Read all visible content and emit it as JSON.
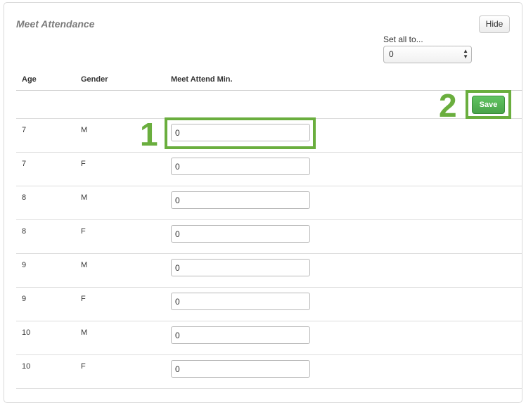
{
  "panel": {
    "title": "Meet Attendance",
    "hide_label": "Hide",
    "set_all_label": "Set all to...",
    "set_all_value": "0"
  },
  "table": {
    "headers": [
      "Age",
      "Gender",
      "Meet Attend Min."
    ],
    "save_label": "Save",
    "rows": [
      {
        "age": "7",
        "gender": "M",
        "min": "0"
      },
      {
        "age": "7",
        "gender": "F",
        "min": "0"
      },
      {
        "age": "8",
        "gender": "M",
        "min": "0"
      },
      {
        "age": "8",
        "gender": "F",
        "min": "0"
      },
      {
        "age": "9",
        "gender": "M",
        "min": "0"
      },
      {
        "age": "9",
        "gender": "F",
        "min": "0"
      },
      {
        "age": "10",
        "gender": "M",
        "min": "0"
      },
      {
        "age": "10",
        "gender": "F",
        "min": "0"
      }
    ]
  },
  "callouts": [
    "1",
    "2"
  ],
  "colors": {
    "callout_green": "#6aae3e",
    "save_green": "#4aa44a"
  }
}
